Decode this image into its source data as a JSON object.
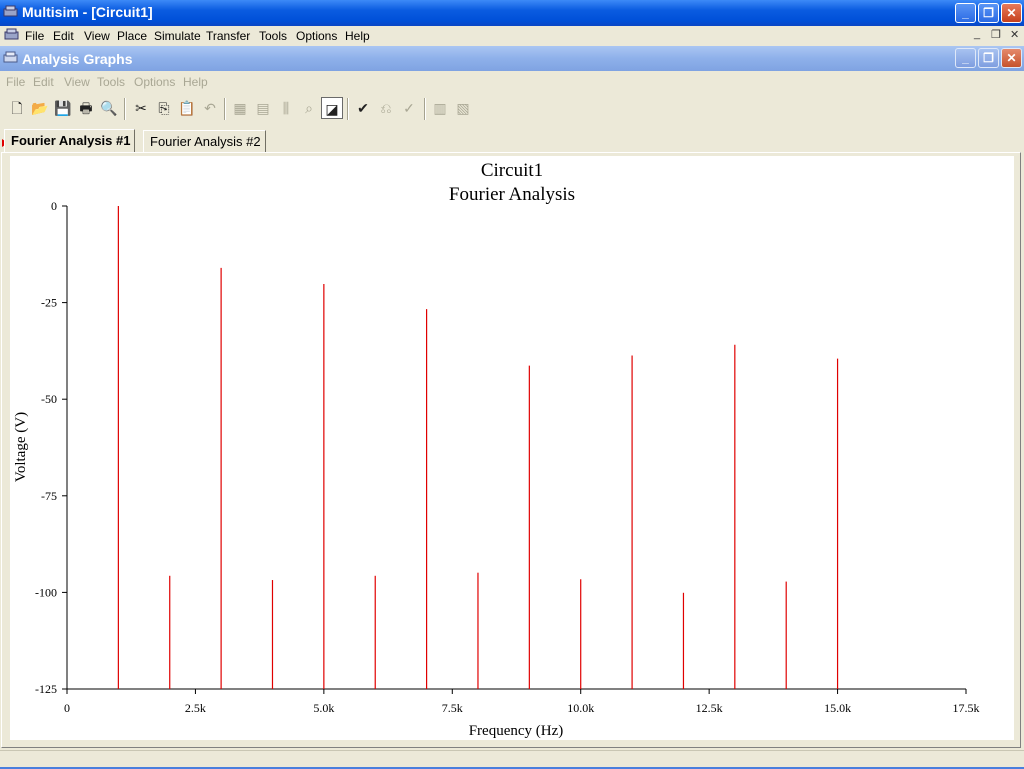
{
  "window": {
    "title": "Multisim - [Circuit1]"
  },
  "menu": [
    "File",
    "Edit",
    "View",
    "Place",
    "Simulate",
    "Transfer",
    "Tools",
    "Options",
    "Help"
  ],
  "subwindow": {
    "title": "Analysis Graphs"
  },
  "submenu": [
    "File",
    "Edit",
    "View",
    "Tools",
    "Options",
    "Help"
  ],
  "toolbar": [
    "new-icon",
    "open-icon",
    "save-icon",
    "print-icon",
    "print-preview-icon",
    "cut-icon",
    "copy-icon",
    "paste-icon",
    "undo-icon",
    "grid-icon",
    "legend-icon",
    "cursors-icon",
    "zoom-out-icon",
    "reverse-colors-icon",
    "properties-icon",
    "overlay-traces-icon",
    "select-marks-icon",
    "export-excel-icon",
    "export-mathcad-icon"
  ],
  "tabs": [
    {
      "label": "Fourier Analysis #1",
      "active": true
    },
    {
      "label": "Fourier Analysis #2",
      "active": false
    }
  ],
  "chart_data": {
    "type": "bar",
    "title": "Circuit1",
    "subtitle": "Fourier Analysis",
    "xlabel": "Frequency (Hz)",
    "ylabel": "Voltage (V)",
    "xlim": [
      0,
      17500
    ],
    "ylim": [
      -125,
      0
    ],
    "x_ticks": [
      {
        "value": 0,
        "label": "0"
      },
      {
        "value": 2500,
        "label": "2.5k"
      },
      {
        "value": 5000,
        "label": "5.0k"
      },
      {
        "value": 7500,
        "label": "7.5k"
      },
      {
        "value": 10000,
        "label": "10.0k"
      },
      {
        "value": 12500,
        "label": "12.5k"
      },
      {
        "value": 15000,
        "label": "15.0k"
      },
      {
        "value": 17500,
        "label": "17.5k"
      }
    ],
    "y_ticks": [
      {
        "value": 0,
        "label": "0"
      },
      {
        "value": -25,
        "label": "-25"
      },
      {
        "value": -50,
        "label": "-50"
      },
      {
        "value": -75,
        "label": "-75"
      },
      {
        "value": -100,
        "label": "-100"
      },
      {
        "value": -125,
        "label": "-125"
      }
    ],
    "grid": false,
    "color": "#e00000",
    "points": [
      {
        "x": 1000,
        "y": 0
      },
      {
        "x": 2000,
        "y": -95.7
      },
      {
        "x": 3000,
        "y": -16
      },
      {
        "x": 4000,
        "y": -96.8
      },
      {
        "x": 5000,
        "y": -20.2
      },
      {
        "x": 6000,
        "y": -95.7
      },
      {
        "x": 7000,
        "y": -26.7
      },
      {
        "x": 8000,
        "y": -94.9
      },
      {
        "x": 9000,
        "y": -41.3
      },
      {
        "x": 10000,
        "y": -96.6
      },
      {
        "x": 11000,
        "y": -38.7
      },
      {
        "x": 12000,
        "y": -100.1
      },
      {
        "x": 13000,
        "y": -35.9
      },
      {
        "x": 14000,
        "y": -97.2
      },
      {
        "x": 15000,
        "y": -39.5
      }
    ]
  }
}
